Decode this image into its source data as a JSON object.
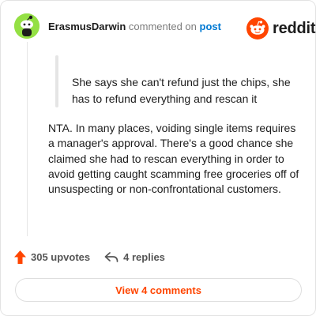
{
  "comment": {
    "username": "ErasmusDarwin",
    "action_text": "commented on",
    "link_text": "post",
    "quote": "She says she can't refund just the chips, she has to refund everything and rescan it",
    "body": "NTA. In many places, voiding single items requires a manager's approval. There's a good chance she claimed she had to rescan everything in order to avoid getting caught scamming free groceries off of unsuspecting or non-confrontational customers.",
    "upvotes": "305 upvotes",
    "replies": "4 replies"
  },
  "brand": {
    "logo_text": "reddit",
    "color": "#ff4500"
  },
  "footer": {
    "view_button": "View 4 comments"
  },
  "icons": [
    "avatar-snoo",
    "reddit-logo-icon",
    "upvote-arrow-icon",
    "reply-arrow-icon"
  ]
}
